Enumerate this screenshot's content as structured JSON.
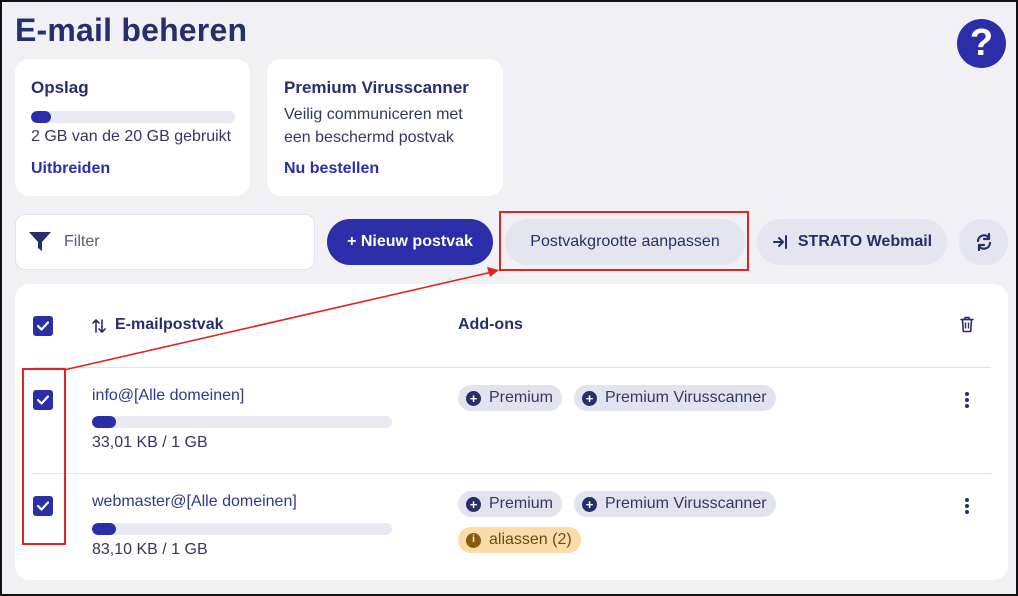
{
  "page": {
    "title": "E-mail beheren",
    "help_symbol": "?"
  },
  "storage": {
    "title": "Opslag",
    "usage_text": "2 GB van de 20 GB gebruikt",
    "used_fraction": 0.1,
    "link": "Uitbreiden"
  },
  "virus": {
    "title": "Premium Virusscanner",
    "line1": "Veilig communiceren met",
    "line2": "een beschermd postvak",
    "link": "Nu bestellen"
  },
  "toolbar": {
    "filter_placeholder": "Filter",
    "new_mailbox": "+ Nieuw postvak",
    "resize_mailbox": "Postvakgrootte aanpassen",
    "webmail": "STRATO Webmail"
  },
  "table": {
    "col_mailbox": "E-mailpostvak",
    "col_addons": "Add-ons",
    "rows": [
      {
        "email": "info@[Alle domeinen]",
        "size": "33,01 KB / 1 GB",
        "used_fraction": 0.08,
        "addons": [
          "Premium",
          "Premium Virusscanner"
        ]
      },
      {
        "email": "webmaster@[Alle domeinen]",
        "size": "83,10 KB / 1 GB",
        "used_fraction": 0.08,
        "addons": [
          "Premium",
          "Premium Virusscanner"
        ],
        "alias": "aliassen (2)"
      }
    ]
  },
  "colors": {
    "primary": "#2b2ea8",
    "annotation": "#e02424",
    "alias_bg": "#fadcaa"
  }
}
